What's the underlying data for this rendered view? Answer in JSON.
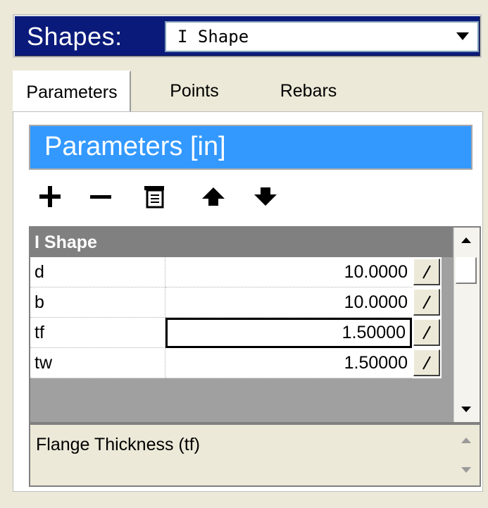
{
  "shapes_bar": {
    "label": "Shapes:",
    "selected_shape": "I Shape"
  },
  "tabs": [
    {
      "label": "Parameters",
      "active": true
    },
    {
      "label": "Points",
      "active": false
    },
    {
      "label": "Rebars",
      "active": false
    }
  ],
  "panel": {
    "header": "Parameters [in]"
  },
  "toolbar": {
    "icons": [
      "add-icon",
      "remove-icon",
      "properties-icon",
      "move-up-icon",
      "move-down-icon"
    ]
  },
  "grid": {
    "header": "I Shape",
    "rows": [
      {
        "name": "d",
        "value": "10.0000"
      },
      {
        "name": "b",
        "value": "10.0000"
      },
      {
        "name": "tf",
        "value": "1.50000",
        "selected": true
      },
      {
        "name": "tw",
        "value": "1.50000"
      }
    ]
  },
  "description": {
    "text": "Flange Thickness (tf)"
  },
  "colors": {
    "shapes_bar_bg": "#0a1a7a",
    "param_header_bg": "#3399ff",
    "grid_header_bg": "#808080"
  }
}
